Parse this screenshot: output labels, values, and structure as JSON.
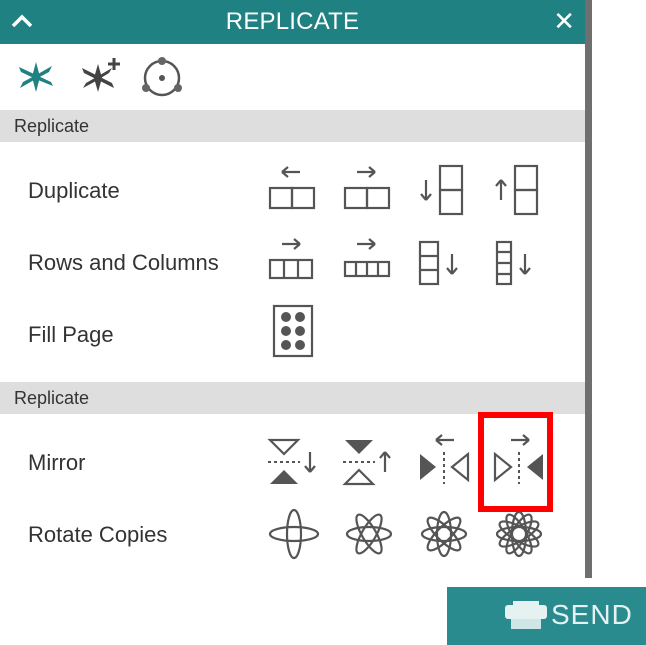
{
  "window": {
    "title": "REPLICATE"
  },
  "tabs": [
    {
      "name": "replicate-tab",
      "icon": "replicate-star-icon",
      "active": true
    },
    {
      "name": "replicate-add-tab",
      "icon": "replicate-star-plus-icon",
      "active": false
    },
    {
      "name": "rotate-tab",
      "icon": "circle-rotate-icon",
      "active": false
    }
  ],
  "sections": {
    "first_header": "Replicate",
    "second_header": "Replicate"
  },
  "rows": {
    "duplicate": "Duplicate",
    "rows_columns": "Rows and Columns",
    "fill_page": "Fill Page",
    "mirror": "Mirror",
    "rotate_copies": "Rotate Copies"
  },
  "send_button": {
    "label": "SEND"
  },
  "colors": {
    "titlebar": "#1f8181",
    "accent": "#2a8b8f",
    "highlight": "#ff0000"
  }
}
